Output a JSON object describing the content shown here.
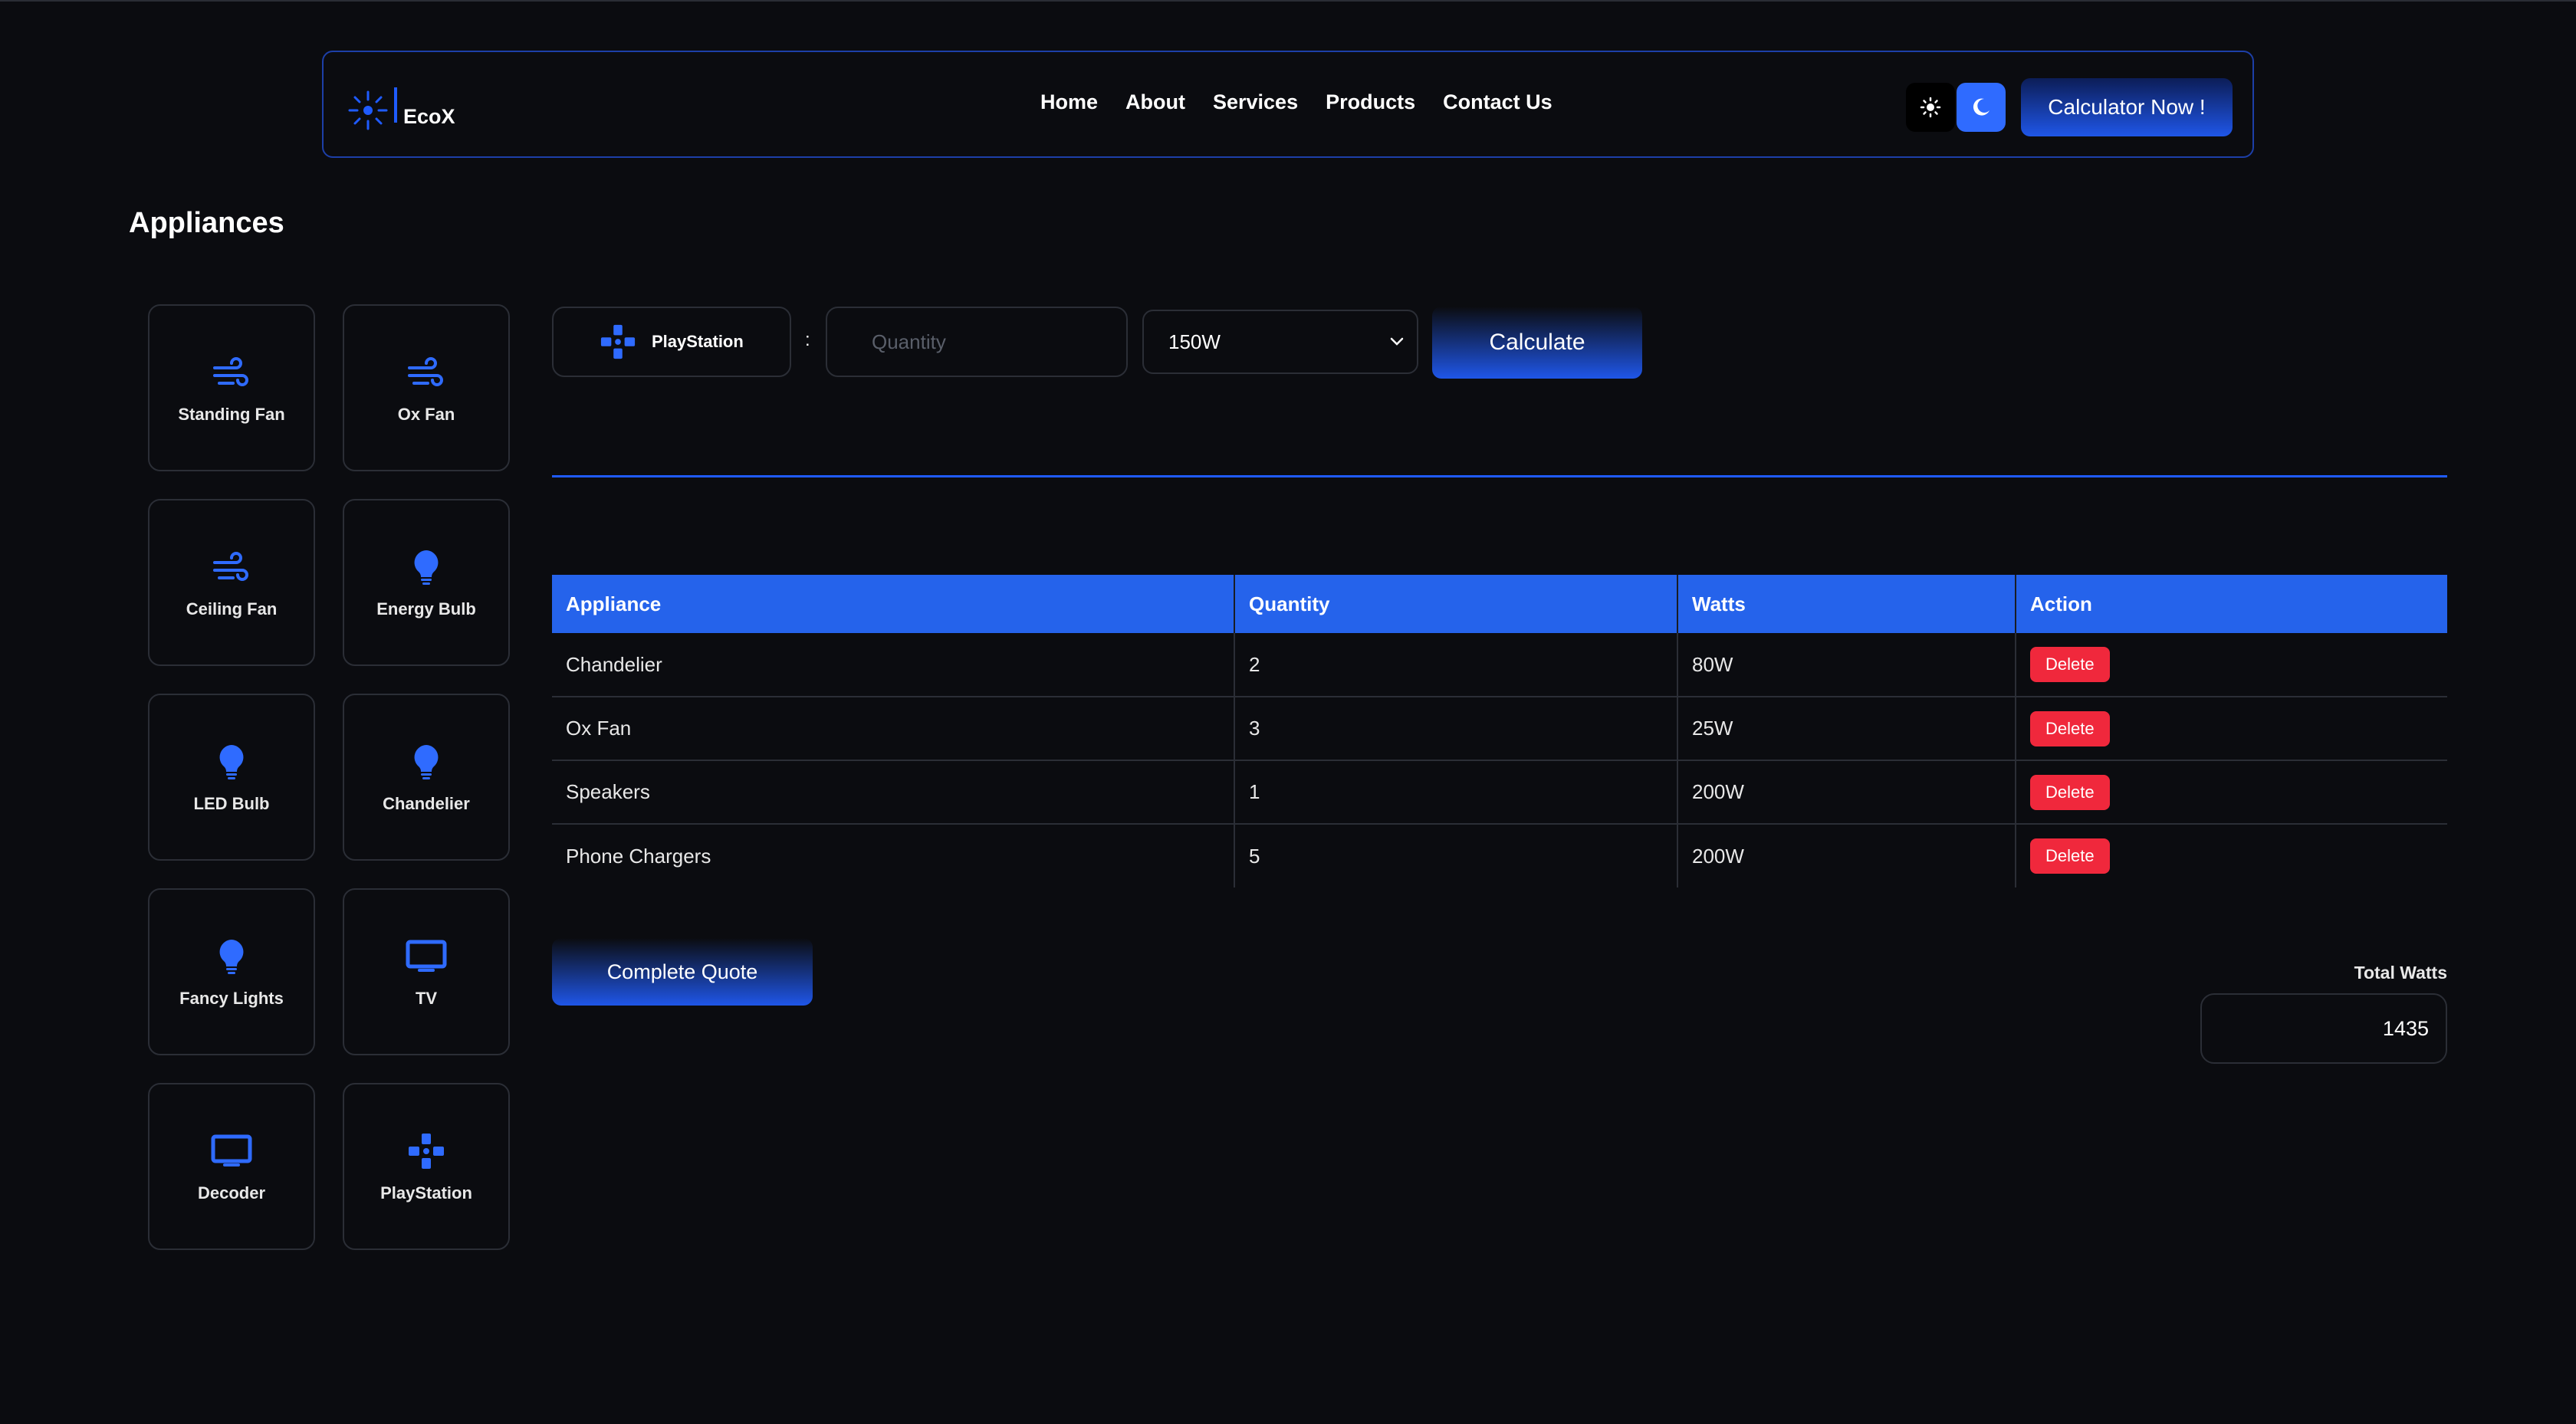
{
  "navbar": {
    "brand": "EcoX",
    "links": [
      "Home",
      "About",
      "Services",
      "Products",
      "Contact Us"
    ],
    "cta_label": "Calculator Now !",
    "accent_color": "#2563eb"
  },
  "page_title": "Appliances",
  "appliances": [
    {
      "label": "Standing Fan",
      "icon": "wind-icon"
    },
    {
      "label": "Ox Fan",
      "icon": "wind-icon"
    },
    {
      "label": "Ceiling Fan",
      "icon": "wind-icon"
    },
    {
      "label": "Energy Bulb",
      "icon": "bulb-icon"
    },
    {
      "label": "LED Bulb",
      "icon": "bulb-icon"
    },
    {
      "label": "Chandelier",
      "icon": "bulb-icon"
    },
    {
      "label": "Fancy Lights",
      "icon": "bulb-icon"
    },
    {
      "label": "TV",
      "icon": "tv-icon"
    },
    {
      "label": "Decoder",
      "icon": "tv-icon"
    },
    {
      "label": "PlayStation",
      "icon": "gamepad-icon"
    }
  ],
  "calculator": {
    "selected_appliance": "PlayStation",
    "separator": ":",
    "quantity_placeholder": "Quantity",
    "watts_selected": "150W",
    "calculate_label": "Calculate"
  },
  "table": {
    "headers": [
      "Appliance",
      "Quantity",
      "Watts",
      "Action"
    ],
    "rows": [
      {
        "appliance": "Chandelier",
        "quantity": "2",
        "watts": "80W",
        "action": "Delete"
      },
      {
        "appliance": "Ox Fan",
        "quantity": "3",
        "watts": "25W",
        "action": "Delete"
      },
      {
        "appliance": "Speakers",
        "quantity": "1",
        "watts": "200W",
        "action": "Delete"
      },
      {
        "appliance": "Phone Chargers",
        "quantity": "5",
        "watts": "200W",
        "action": "Delete"
      }
    ]
  },
  "complete_label": "Complete Quote",
  "total": {
    "label": "Total Watts",
    "value": "1435"
  },
  "colors": {
    "delete": "#f0283c",
    "border": "#1d3fa8",
    "background": "#0b0c10"
  }
}
